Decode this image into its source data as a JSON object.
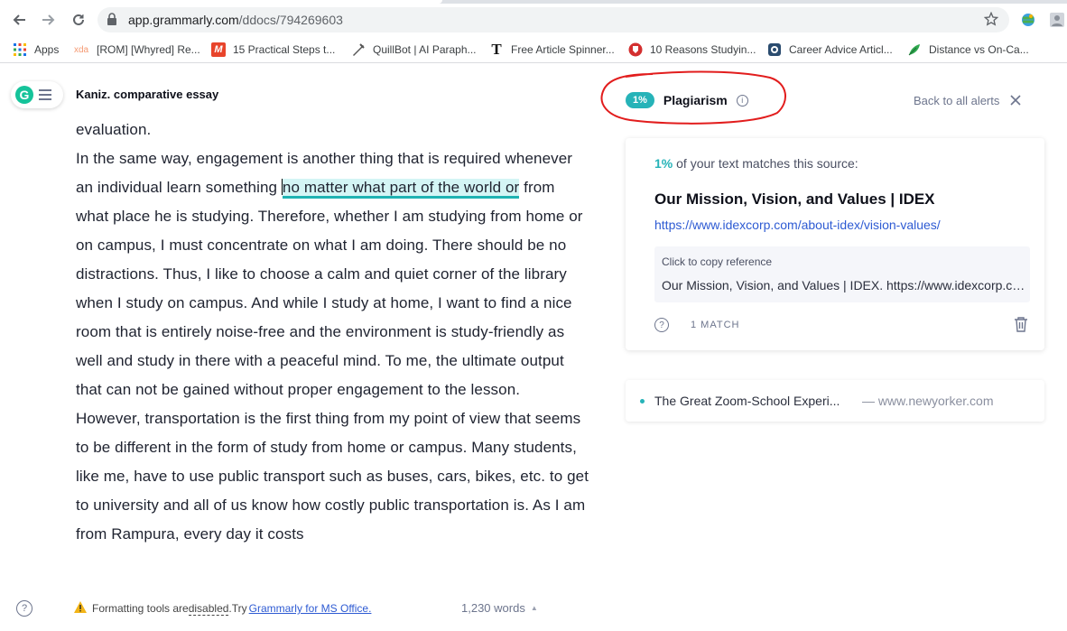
{
  "browser": {
    "url_host": "app.grammarly.com",
    "url_path": "/ddocs/794269603"
  },
  "bookmarks": [
    {
      "label": "Apps",
      "icon": "apps-grid-icon"
    },
    {
      "label": "[ROM] [Whyred] Re...",
      "icon": "xda-icon",
      "prefix": "xda"
    },
    {
      "label": "15 Practical Steps t...",
      "icon": "m-logo-icon",
      "prefix": "M"
    },
    {
      "label": "QuillBot | AI Paraph...",
      "icon": "quillbot-icon"
    },
    {
      "label": "Free Article Spinner...",
      "icon": "t-logo-icon",
      "prefix": "T"
    },
    {
      "label": "10 Reasons Studyin...",
      "icon": "shield-red-icon"
    },
    {
      "label": "Career Advice Articl...",
      "icon": "career-icon"
    },
    {
      "label": "Distance vs On-Ca...",
      "icon": "leaf-icon"
    }
  ],
  "doc": {
    "title": "Kaniz. comparative essay",
    "line_eval": "evaluation.",
    "p1_before": "In the same way, engagement is another thing that is required whenever an individual learn something ",
    "p1_highlight": "no matter what part of the world or",
    "p1_after": " from what place he is studying. Therefore, whether I am studying from home or on campus, I must concentrate on what I am doing. There should be no distractions. Thus, I like to choose a calm and quiet corner of the library when I study on campus. And while I study at home, I want to find a nice room that is entirely noise-free and the environment is study-friendly as well and study in there with a peaceful mind. To me, the ultimate output that can not be gained without proper engagement to the lesson.",
    "p2": "However, transportation is the first thing from my point of view that seems to be different in the form of study from home or campus. Many students, like me, have to use public transport such as buses, cars, bikes, etc. to get to university and all of us know how costly public transportation is. As I am from Rampura, every day it costs"
  },
  "status": {
    "warn_prefix": "Formatting tools are ",
    "warn_disabled": "disabled",
    "warn_try": ".Try",
    "warn_link": "Grammarly for MS Office.",
    "word_count": "1,230 words"
  },
  "panel": {
    "pct": "1%",
    "title": "Plagiarism",
    "back": "Back to all alerts",
    "match_pct": "1%",
    "match_text": "of your text matches this source:",
    "source_title": "Our Mission, Vision, and Values | IDEX",
    "source_url": "https://www.idexcorp.com/about-idex/vision-values/",
    "ref_label": "Click to copy reference",
    "ref_text": "Our Mission, Vision, and Values | IDEX. https://www.idexcorp.com/about-idex/vision-values/",
    "match_count": "1 MATCH",
    "other_title": "The Great Zoom-School Experi...",
    "other_source": "— www.newyorker.com"
  },
  "colors": {
    "accent_teal": "#26b3b8",
    "grammarly_green": "#15c39a",
    "link_blue": "#2e5bd3",
    "annotation_red": "#e21d1d"
  }
}
